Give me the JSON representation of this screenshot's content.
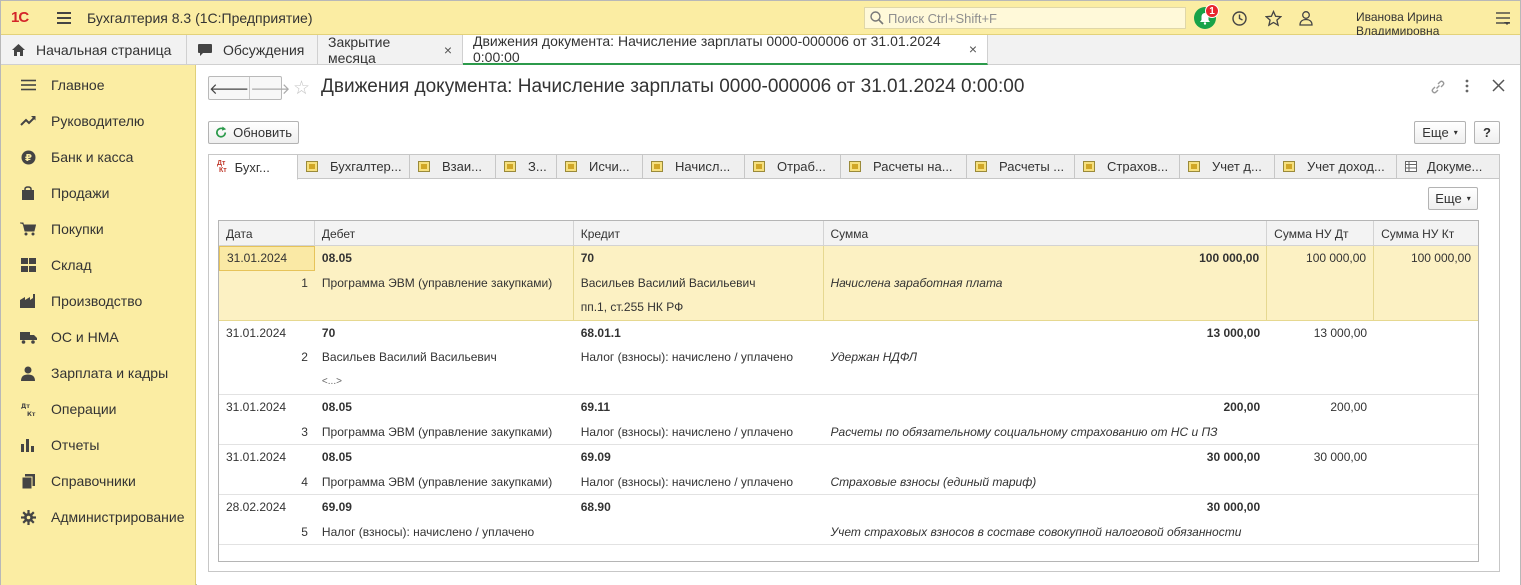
{
  "topbar": {
    "logo": "1С",
    "app_title": "Бухгалтерия 8.3  (1С:Предприятие)",
    "search_placeholder": "Поиск Ctrl+Shift+F",
    "notifications_count": "1",
    "user_name": "Иванова Ирина Владимировна"
  },
  "tabs": [
    {
      "label": "Начальная страница",
      "icon": "home-icon"
    },
    {
      "label": "Обсуждения",
      "icon": "chat-icon"
    },
    {
      "label": "Закрытие месяца",
      "close": "×"
    },
    {
      "label": "Движения документа: Начисление зарплаты 0000-000006 от 31.01.2024 0:00:00",
      "close": "×"
    }
  ],
  "sidebar": {
    "items": [
      {
        "label": "Главное",
        "icon": "menu-list-icon"
      },
      {
        "label": "Руководителю",
        "icon": "trend-icon"
      },
      {
        "label": "Банк и касса",
        "icon": "ruble-icon"
      },
      {
        "label": "Продажи",
        "icon": "bag-icon"
      },
      {
        "label": "Покупки",
        "icon": "cart-icon"
      },
      {
        "label": "Склад",
        "icon": "warehouse-icon"
      },
      {
        "label": "Производство",
        "icon": "factory-icon"
      },
      {
        "label": "ОС и НМА",
        "icon": "truck-icon"
      },
      {
        "label": "Зарплата и кадры",
        "icon": "person-icon"
      },
      {
        "label": "Операции",
        "icon": "dt-kt-icon"
      },
      {
        "label": "Отчеты",
        "icon": "bar-chart-icon"
      },
      {
        "label": "Справочники",
        "icon": "book-icon"
      },
      {
        "label": "Администрирование",
        "icon": "gear-icon"
      }
    ]
  },
  "main": {
    "title": "Движения документа: Начисление зарплаты 0000-000006 от 31.01.2024 0:00:00",
    "refresh_label": "Обновить",
    "more_label": "Еще",
    "help_label": "?",
    "inner_more_label": "Еще",
    "register_tabs": [
      "Бухг...",
      "Бухгалтер...",
      "Взаи...",
      "З...",
      "Исчи...",
      "Начисл...",
      "Отраб...",
      "Расчеты на...",
      "Расчеты ...",
      "Страхов...",
      "Учет д...",
      "Учет доход...",
      "Докуме..."
    ],
    "table": {
      "headers": [
        "Дата",
        "Дебет",
        "Кредит",
        "Сумма",
        "Сумма НУ Дт",
        "Сумма НУ Кт"
      ],
      "records": [
        {
          "date": "31.01.2024",
          "n": "1",
          "debit": "08.05",
          "credit": "70",
          "sum": "100 000,00",
          "nu_dt": "100 000,00",
          "nu_kt": "100 000,00",
          "debit_sub": [
            "Программа ЭВМ (управление закупками)"
          ],
          "credit_sub": [
            "Васильев Василий Васильевич",
            "пп.1, ст.255 НК РФ"
          ],
          "content": "Начислена заработная плата"
        },
        {
          "date": "31.01.2024",
          "n": "2",
          "debit": "70",
          "credit": "68.01.1",
          "sum": "13 000,00",
          "nu_dt": "13 000,00",
          "nu_kt": "",
          "debit_sub": [
            "Васильев Василий Васильевич",
            "<...>"
          ],
          "credit_sub": [
            "Налог (взносы): начислено / уплачено"
          ],
          "content": "Удержан НДФЛ"
        },
        {
          "date": "31.01.2024",
          "n": "3",
          "debit": "08.05",
          "credit": "69.11",
          "sum": "200,00",
          "nu_dt": "200,00",
          "nu_kt": "",
          "debit_sub": [
            "Программа ЭВМ (управление закупками)"
          ],
          "credit_sub": [
            "Налог (взносы): начислено / уплачено"
          ],
          "content": "Расчеты по обязательному социальному страхованию от НС и ПЗ"
        },
        {
          "date": "31.01.2024",
          "n": "4",
          "debit": "08.05",
          "credit": "69.09",
          "sum": "30 000,00",
          "nu_dt": "30 000,00",
          "nu_kt": "",
          "debit_sub": [
            "Программа ЭВМ (управление закупками)"
          ],
          "credit_sub": [
            "Налог (взносы): начислено / уплачено"
          ],
          "content": "Страховые взносы (единый тариф)"
        },
        {
          "date": "28.02.2024",
          "n": "5",
          "debit": "69.09",
          "credit": "68.90",
          "sum": "30 000,00",
          "nu_dt": "",
          "nu_kt": "",
          "debit_sub": [
            "Налог (взносы): начислено / уплачено"
          ],
          "credit_sub": [],
          "content": "Учет страховых взносов в составе совокупной налоговой обязанности"
        }
      ]
    }
  },
  "colors": {
    "topbar_bg": "#fbeda3",
    "accent_green": "#2c9a4b",
    "badge_red": "#e8262e",
    "selected_row": "#fcf1c3"
  }
}
